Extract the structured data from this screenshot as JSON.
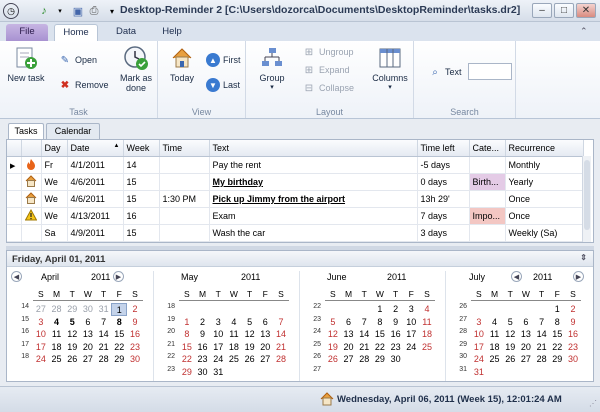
{
  "window": {
    "title": "Desktop-Reminder 2 [C:\\Users\\dozorca\\Documents\\DesktopReminder\\tasks.dr2]"
  },
  "ribbon_tabs": [
    "File",
    "Home",
    "Data",
    "Help"
  ],
  "ribbon": {
    "task": {
      "caption": "Task",
      "new_task": "New task",
      "open": "Open",
      "remove": "Remove",
      "mark_as_done": [
        "Mark as",
        "done"
      ]
    },
    "view": {
      "caption": "View",
      "today": "Today",
      "first": "First",
      "last": "Last"
    },
    "layout": {
      "caption": "Layout",
      "group": "Group",
      "ungroup": "Ungroup",
      "expand": "Expand",
      "collapse": "Collapse",
      "columns": "Columns"
    },
    "search": {
      "caption": "Search",
      "text_label": "Text",
      "text_value": ""
    }
  },
  "view_tabs": [
    "Tasks",
    "Calendar"
  ],
  "grid": {
    "columns": [
      "Day",
      "Date",
      "Week",
      "Time",
      "Text",
      "Time left",
      "Cate...",
      "Recurrence"
    ],
    "rows": [
      {
        "icon": "flame-icon",
        "day": "Fr",
        "date": "4/1/2011",
        "week": "14",
        "time": "",
        "text": "Pay the rent",
        "bold": false,
        "time_left": "-5 days",
        "category": "",
        "recurrence": "Monthly",
        "current": true
      },
      {
        "icon": "house-icon",
        "day": "We",
        "date": "4/6/2011",
        "week": "15",
        "time": "",
        "text": "My birthday",
        "bold": true,
        "time_left": "0 days",
        "category": "Birth...",
        "recurrence": "Yearly"
      },
      {
        "icon": "house-icon",
        "day": "We",
        "date": "4/6/2011",
        "week": "15",
        "time": "1:30 PM",
        "text": "Pick up Jimmy from the airport",
        "bold": true,
        "time_left": "13h 29'",
        "category": "",
        "recurrence": "Once"
      },
      {
        "icon": "warning-icon",
        "day": "We",
        "date": "4/13/2011",
        "week": "16",
        "time": "",
        "text": "Exam",
        "bold": false,
        "time_left": "7 days",
        "category": "Impo...",
        "recurrence": "Once"
      },
      {
        "icon": "",
        "day": "Sa",
        "date": "4/9/2011",
        "week": "15",
        "time": "",
        "text": "Wash the car",
        "bold": false,
        "time_left": "3 days",
        "category": "",
        "recurrence": "Weekly (Sa)"
      }
    ]
  },
  "calendar": {
    "header": "Friday, April 01, 2011",
    "dow": [
      "S",
      "M",
      "T",
      "W",
      "T",
      "F",
      "S"
    ],
    "months": [
      {
        "name": "April",
        "year": "2011",
        "weeks": [
          "14",
          "15",
          "16",
          "17",
          "18",
          ""
        ],
        "days": [
          "27",
          "28",
          "29",
          "30",
          "31",
          "1",
          "2",
          "3",
          "4",
          "5",
          "6",
          "7",
          "8",
          "9",
          "10",
          "11",
          "12",
          "13",
          "14",
          "15",
          "16",
          "17",
          "18",
          "19",
          "20",
          "21",
          "22",
          "23",
          "24",
          "25",
          "26",
          "27",
          "28",
          "29",
          "30"
        ],
        "other": [
          0,
          1,
          2,
          3,
          4
        ],
        "today": 5,
        "bold": [
          8,
          9,
          12
        ]
      },
      {
        "name": "May",
        "year": "2011",
        "weeks": [
          "18",
          "19",
          "20",
          "21",
          "22",
          "23"
        ],
        "days": [
          "",
          "",
          "",
          "",
          "",
          "",
          "",
          "1",
          "2",
          "3",
          "4",
          "5",
          "6",
          "7",
          "8",
          "9",
          "10",
          "11",
          "12",
          "13",
          "14",
          "15",
          "16",
          "17",
          "18",
          "19",
          "20",
          "21",
          "22",
          "23",
          "24",
          "25",
          "26",
          "27",
          "28",
          "29",
          "30",
          "31"
        ],
        "other": [],
        "today": -1,
        "bold": []
      },
      {
        "name": "June",
        "year": "2011",
        "weeks": [
          "22",
          "23",
          "24",
          "25",
          "26",
          "27"
        ],
        "days": [
          "",
          "",
          "",
          "1",
          "2",
          "3",
          "4",
          "5",
          "6",
          "7",
          "8",
          "9",
          "10",
          "11",
          "12",
          "13",
          "14",
          "15",
          "16",
          "17",
          "18",
          "19",
          "20",
          "21",
          "22",
          "23",
          "24",
          "25",
          "26",
          "27",
          "28",
          "29",
          "30"
        ],
        "other": [],
        "today": -1,
        "bold": []
      },
      {
        "name": "July",
        "year": "2011",
        "weeks": [
          "26",
          "27",
          "28",
          "29",
          "30",
          "31"
        ],
        "days": [
          "",
          "",
          "",
          "",
          "",
          "1",
          "2",
          "3",
          "4",
          "5",
          "6",
          "7",
          "8",
          "9",
          "10",
          "11",
          "12",
          "13",
          "14",
          "15",
          "16",
          "17",
          "18",
          "19",
          "20",
          "21",
          "22",
          "23",
          "24",
          "25",
          "26",
          "27",
          "28",
          "29",
          "30",
          "31"
        ],
        "other": [],
        "today": -1,
        "bold": []
      }
    ]
  },
  "status": {
    "text": "Wednesday, April 06, 2011 (Week 15), 12:01:24 AM"
  },
  "colors": {
    "accent": "#3a67b0",
    "file_tab": "#a892d1",
    "weekend": "#c03030"
  }
}
